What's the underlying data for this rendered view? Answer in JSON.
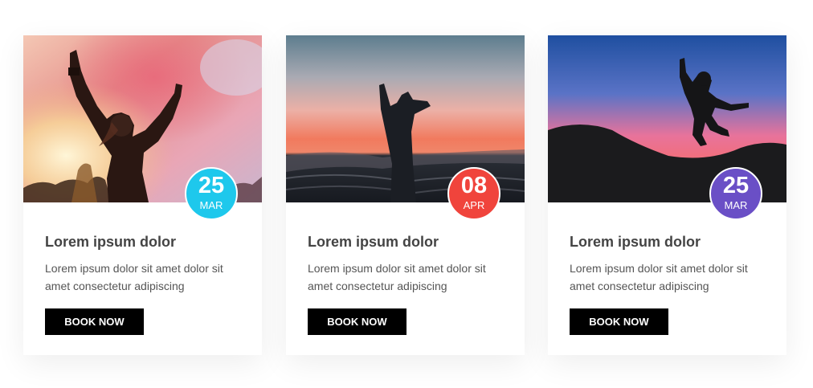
{
  "cards": [
    {
      "image": "concert-woman-colored-smoke",
      "day": "25",
      "month": "MAR",
      "badge_color": "#1ec8ec",
      "title": "Lorem ipsum dolor",
      "text": "Lorem ipsum dolor sit amet dolor sit amet consectetur adipiscing",
      "button": "BOOK NOW"
    },
    {
      "image": "hand-silhouette-sunset-sea",
      "day": "08",
      "month": "APR",
      "badge_color": "#f0443c",
      "title": "Lorem ipsum dolor",
      "text": "Lorem ipsum dolor sit amet dolor sit amet consectetur adipiscing",
      "button": "BOOK NOW"
    },
    {
      "image": "jumping-person-silhouette-dusk",
      "day": "25",
      "month": "MAR",
      "badge_color": "#6a4fc6",
      "title": "Lorem ipsum dolor",
      "text": "Lorem ipsum dolor sit amet dolor sit amet consectetur adipiscing",
      "button": "BOOK NOW"
    }
  ]
}
